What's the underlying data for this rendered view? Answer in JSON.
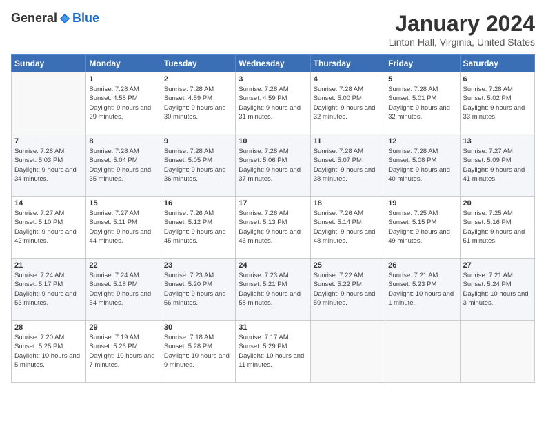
{
  "logo": {
    "general": "General",
    "blue": "Blue"
  },
  "header": {
    "month": "January 2024",
    "location": "Linton Hall, Virginia, United States"
  },
  "weekdays": [
    "Sunday",
    "Monday",
    "Tuesday",
    "Wednesday",
    "Thursday",
    "Friday",
    "Saturday"
  ],
  "weeks": [
    [
      {
        "day": "",
        "info": ""
      },
      {
        "day": "1",
        "info": "Sunrise: 7:28 AM\nSunset: 4:58 PM\nDaylight: 9 hours\nand 29 minutes."
      },
      {
        "day": "2",
        "info": "Sunrise: 7:28 AM\nSunset: 4:59 PM\nDaylight: 9 hours\nand 30 minutes."
      },
      {
        "day": "3",
        "info": "Sunrise: 7:28 AM\nSunset: 4:59 PM\nDaylight: 9 hours\nand 31 minutes."
      },
      {
        "day": "4",
        "info": "Sunrise: 7:28 AM\nSunset: 5:00 PM\nDaylight: 9 hours\nand 32 minutes."
      },
      {
        "day": "5",
        "info": "Sunrise: 7:28 AM\nSunset: 5:01 PM\nDaylight: 9 hours\nand 32 minutes."
      },
      {
        "day": "6",
        "info": "Sunrise: 7:28 AM\nSunset: 5:02 PM\nDaylight: 9 hours\nand 33 minutes."
      }
    ],
    [
      {
        "day": "7",
        "info": "Sunrise: 7:28 AM\nSunset: 5:03 PM\nDaylight: 9 hours\nand 34 minutes."
      },
      {
        "day": "8",
        "info": "Sunrise: 7:28 AM\nSunset: 5:04 PM\nDaylight: 9 hours\nand 35 minutes."
      },
      {
        "day": "9",
        "info": "Sunrise: 7:28 AM\nSunset: 5:05 PM\nDaylight: 9 hours\nand 36 minutes."
      },
      {
        "day": "10",
        "info": "Sunrise: 7:28 AM\nSunset: 5:06 PM\nDaylight: 9 hours\nand 37 minutes."
      },
      {
        "day": "11",
        "info": "Sunrise: 7:28 AM\nSunset: 5:07 PM\nDaylight: 9 hours\nand 38 minutes."
      },
      {
        "day": "12",
        "info": "Sunrise: 7:28 AM\nSunset: 5:08 PM\nDaylight: 9 hours\nand 40 minutes."
      },
      {
        "day": "13",
        "info": "Sunrise: 7:27 AM\nSunset: 5:09 PM\nDaylight: 9 hours\nand 41 minutes."
      }
    ],
    [
      {
        "day": "14",
        "info": "Sunrise: 7:27 AM\nSunset: 5:10 PM\nDaylight: 9 hours\nand 42 minutes."
      },
      {
        "day": "15",
        "info": "Sunrise: 7:27 AM\nSunset: 5:11 PM\nDaylight: 9 hours\nand 44 minutes."
      },
      {
        "day": "16",
        "info": "Sunrise: 7:26 AM\nSunset: 5:12 PM\nDaylight: 9 hours\nand 45 minutes."
      },
      {
        "day": "17",
        "info": "Sunrise: 7:26 AM\nSunset: 5:13 PM\nDaylight: 9 hours\nand 46 minutes."
      },
      {
        "day": "18",
        "info": "Sunrise: 7:26 AM\nSunset: 5:14 PM\nDaylight: 9 hours\nand 48 minutes."
      },
      {
        "day": "19",
        "info": "Sunrise: 7:25 AM\nSunset: 5:15 PM\nDaylight: 9 hours\nand 49 minutes."
      },
      {
        "day": "20",
        "info": "Sunrise: 7:25 AM\nSunset: 5:16 PM\nDaylight: 9 hours\nand 51 minutes."
      }
    ],
    [
      {
        "day": "21",
        "info": "Sunrise: 7:24 AM\nSunset: 5:17 PM\nDaylight: 9 hours\nand 53 minutes."
      },
      {
        "day": "22",
        "info": "Sunrise: 7:24 AM\nSunset: 5:18 PM\nDaylight: 9 hours\nand 54 minutes."
      },
      {
        "day": "23",
        "info": "Sunrise: 7:23 AM\nSunset: 5:20 PM\nDaylight: 9 hours\nand 56 minutes."
      },
      {
        "day": "24",
        "info": "Sunrise: 7:23 AM\nSunset: 5:21 PM\nDaylight: 9 hours\nand 58 minutes."
      },
      {
        "day": "25",
        "info": "Sunrise: 7:22 AM\nSunset: 5:22 PM\nDaylight: 9 hours\nand 59 minutes."
      },
      {
        "day": "26",
        "info": "Sunrise: 7:21 AM\nSunset: 5:23 PM\nDaylight: 10 hours\nand 1 minute."
      },
      {
        "day": "27",
        "info": "Sunrise: 7:21 AM\nSunset: 5:24 PM\nDaylight: 10 hours\nand 3 minutes."
      }
    ],
    [
      {
        "day": "28",
        "info": "Sunrise: 7:20 AM\nSunset: 5:25 PM\nDaylight: 10 hours\nand 5 minutes."
      },
      {
        "day": "29",
        "info": "Sunrise: 7:19 AM\nSunset: 5:26 PM\nDaylight: 10 hours\nand 7 minutes."
      },
      {
        "day": "30",
        "info": "Sunrise: 7:18 AM\nSunset: 5:28 PM\nDaylight: 10 hours\nand 9 minutes."
      },
      {
        "day": "31",
        "info": "Sunrise: 7:17 AM\nSunset: 5:29 PM\nDaylight: 10 hours\nand 11 minutes."
      },
      {
        "day": "",
        "info": ""
      },
      {
        "day": "",
        "info": ""
      },
      {
        "day": "",
        "info": ""
      }
    ]
  ]
}
